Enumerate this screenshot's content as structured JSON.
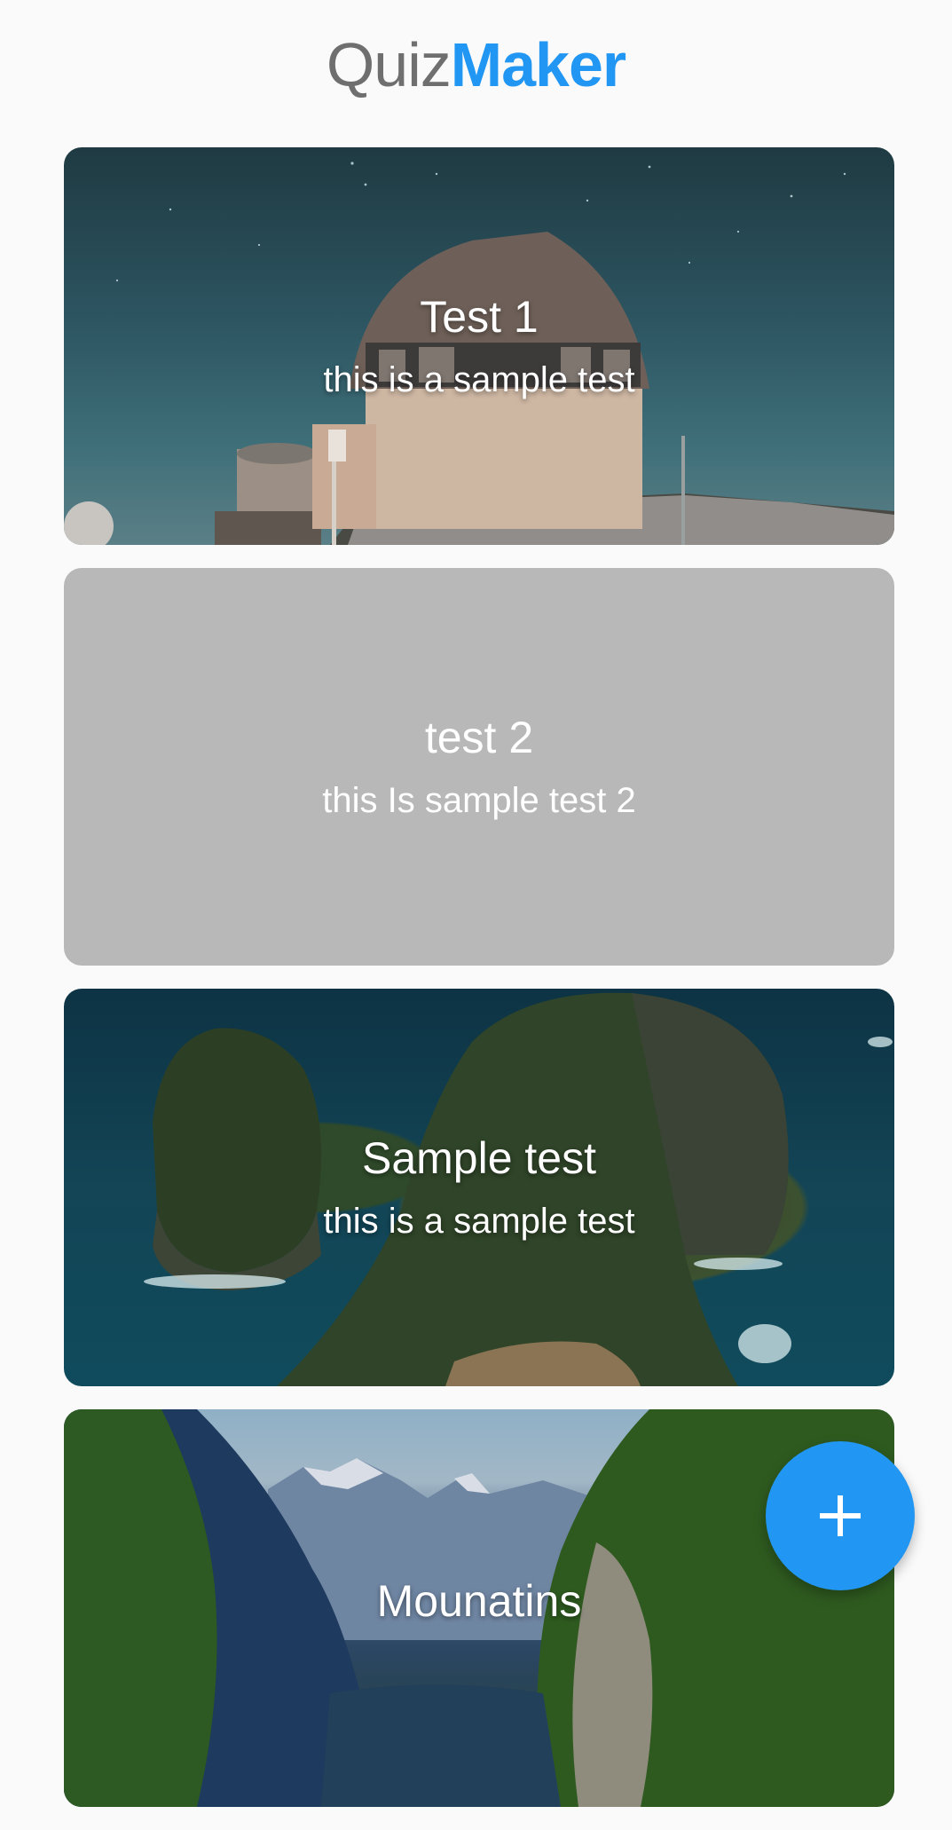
{
  "app": {
    "title_part1": "Quiz",
    "title_part2": "Maker"
  },
  "quizzes": [
    {
      "title": "Test 1",
      "description": "this is a sample test",
      "background": "observatory-photo"
    },
    {
      "title": "test 2",
      "description": "this Is sample test 2",
      "background": "plain-grey"
    },
    {
      "title": "Sample test",
      "description": "this is a sample test",
      "background": "sea-rocks-photo"
    },
    {
      "title": "Mounatins",
      "description": "",
      "background": "mountain-lake-photo"
    }
  ],
  "fab": {
    "icon": "plus-icon",
    "color": "#2196f3"
  },
  "colors": {
    "accent": "#2196f3",
    "title_grey": "#6f6f6f",
    "background": "#fafafa",
    "card_plain": "#b8b8b8"
  }
}
